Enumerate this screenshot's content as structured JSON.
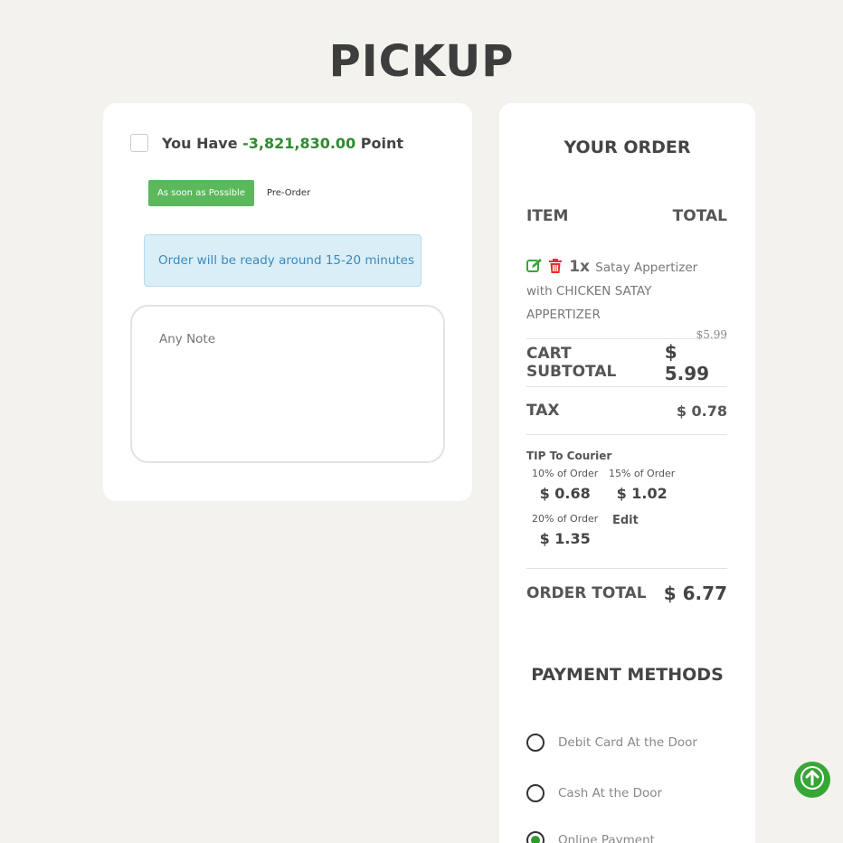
{
  "page": {
    "title": "PICKUP"
  },
  "points": {
    "prefix": "You Have",
    "value": "-3,821,830.00",
    "suffix": "Point"
  },
  "time_options": {
    "asap": "As soon as Possible",
    "preorder": "Pre-Order",
    "selected": "As soon as Possible"
  },
  "ready_message": "Order will be ready around 15-20 minutes",
  "note": {
    "placeholder": "Any Note",
    "value": ""
  },
  "order": {
    "title": "YOUR ORDER",
    "col_item": "ITEM",
    "col_total": "TOTAL",
    "items": [
      {
        "qty": "1x",
        "name": "Satay Appertizer with CHICKEN SATAY APPERTIZER",
        "price": "$5.99",
        "icons": [
          "edit-icon",
          "trash-icon"
        ]
      }
    ],
    "subtotal_label": "CART SUBTOTAL",
    "subtotal_value": "$ 5.99",
    "tax_label": "TAX",
    "tax_value": "$ 0.78",
    "tip": {
      "title": "TIP To Courier",
      "options": [
        {
          "label": "10% of Order",
          "amount": "$ 0.68"
        },
        {
          "label": "15% of Order",
          "amount": "$ 1.02"
        },
        {
          "label": "20% of Order",
          "amount": "$ 1.35"
        }
      ],
      "edit_label": "Edit"
    },
    "total_label": "ORDER TOTAL",
    "total_value": "$ 6.77"
  },
  "payment": {
    "title": "PAYMENT METHODS",
    "methods": [
      {
        "label": "Debit Card At the Door",
        "selected": false
      },
      {
        "label": "Cash At the Door",
        "selected": false
      },
      {
        "label": "Online Payment",
        "selected": true
      }
    ]
  },
  "colors": {
    "accent_green": "#5cb85c",
    "points_green": "#2e8b2e",
    "trash_red": "#e53030",
    "info_bg": "#d9eef7"
  }
}
